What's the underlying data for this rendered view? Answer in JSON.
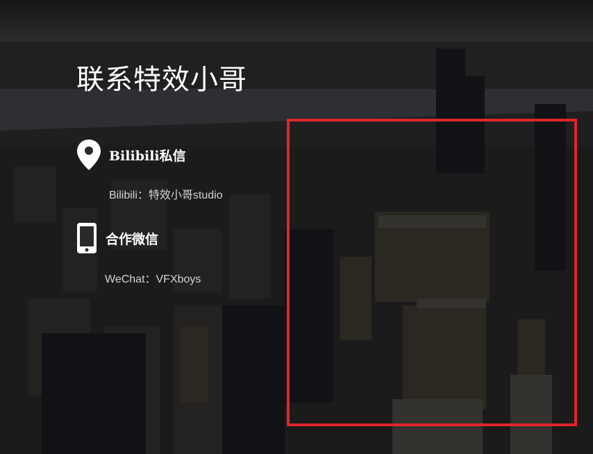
{
  "page": {
    "title": "联系特效小哥"
  },
  "contacts": [
    {
      "label": "Bilibili私信",
      "text": "Bilibili：特效小哥studio",
      "icon": "location-pin-icon"
    },
    {
      "label": "合作微信",
      "text": "WeChat：VFXboys",
      "icon": "mobile-phone-icon"
    }
  ],
  "colors": {
    "highlight_frame": "#e0252c",
    "title_text": "#ffffff",
    "body_text": "#d4d4d4"
  }
}
